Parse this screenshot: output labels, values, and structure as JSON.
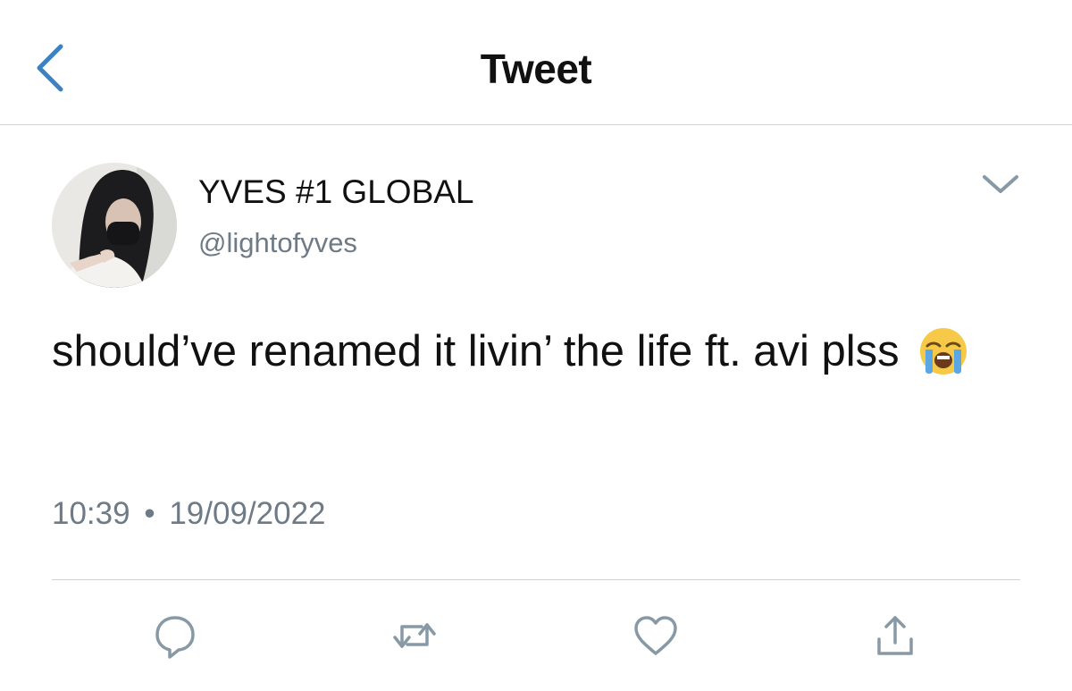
{
  "nav": {
    "title": "Tweet",
    "back_icon": "chevron-left-icon",
    "accent": "#3b82c4"
  },
  "author": {
    "display_name": "YVES #1 GLOBAL",
    "handle": "@lightofyves",
    "avatar": "avatar-photo"
  },
  "tweet": {
    "text": "should’ve renamed it livin’ the life ft. avi plss",
    "emoji": "loudly-crying-face-emoji",
    "time": "10:39",
    "separator": "•",
    "date": "19/09/2022"
  },
  "actions": [
    {
      "name": "reply",
      "icon": "comment-bubble-icon"
    },
    {
      "name": "retweet",
      "icon": "retweet-icon"
    },
    {
      "name": "like",
      "icon": "heart-icon"
    },
    {
      "name": "share",
      "icon": "share-upload-icon"
    }
  ],
  "colors": {
    "text": "#111111",
    "secondary_text": "#6e7a85",
    "icon_gray": "#8899a6",
    "divider": "#cfd3d6"
  }
}
